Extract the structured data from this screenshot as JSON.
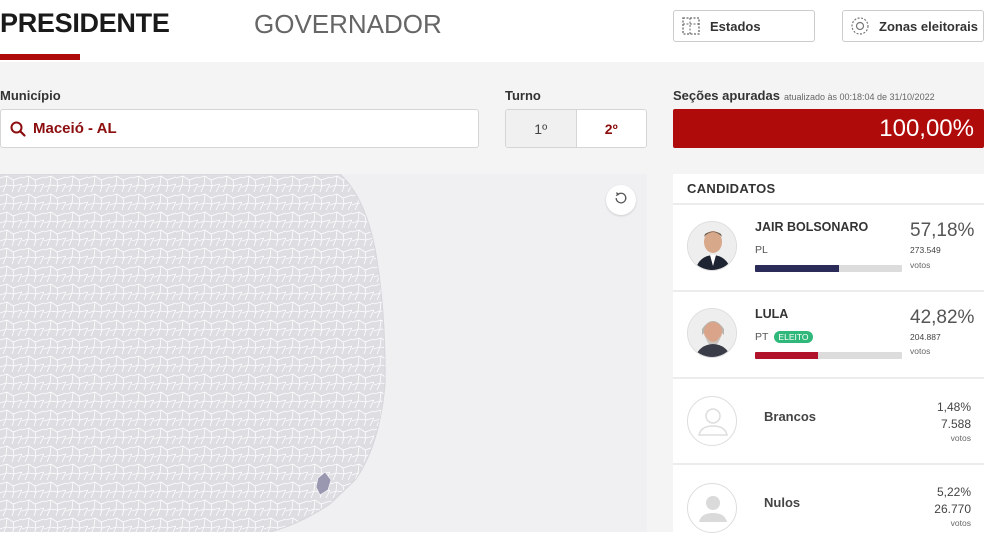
{
  "tabs": {
    "presidente": "PRESIDENTE",
    "governador": "GOVERNADOR"
  },
  "buttons": {
    "estados": "Estados",
    "zonas": "Zonas eleitorais"
  },
  "municipio": {
    "label": "Município",
    "value": "Maceió - AL"
  },
  "turno": {
    "label": "Turno",
    "first": "1º",
    "second": "2º",
    "selected": "2º"
  },
  "secoes": {
    "label": "Seções apuradas",
    "updated": "atualizado às 00:18:04 de 31/10/2022",
    "value": "100,00%",
    "fraction": 1.0
  },
  "candidatos": {
    "title": "CANDIDATOS",
    "list": [
      {
        "name": "JAIR BOLSONARO",
        "party": "PL",
        "pct": "57,18%",
        "votes": "273.549",
        "votes_label": "votos",
        "fraction": 0.5718,
        "color": "#2b2b5a",
        "badge": ""
      },
      {
        "name": "LULA",
        "party": "PT",
        "pct": "42,82%",
        "votes": "204.887",
        "votes_label": "votos",
        "fraction": 0.4282,
        "color": "#b0132a",
        "badge": "ELEITO"
      }
    ],
    "others": [
      {
        "name": "Brancos",
        "pct": "1,48%",
        "votes": "7.588",
        "votes_label": "votos"
      },
      {
        "name": "Nulos",
        "pct": "5,22%",
        "votes": "26.770",
        "votes_label": "votos"
      }
    ]
  },
  "colors": {
    "accent": "#b00b0b",
    "municipio_text": "#8b0d0d",
    "eleito_badge": "#2fb87a",
    "highlight_region": "#9a98b0"
  }
}
